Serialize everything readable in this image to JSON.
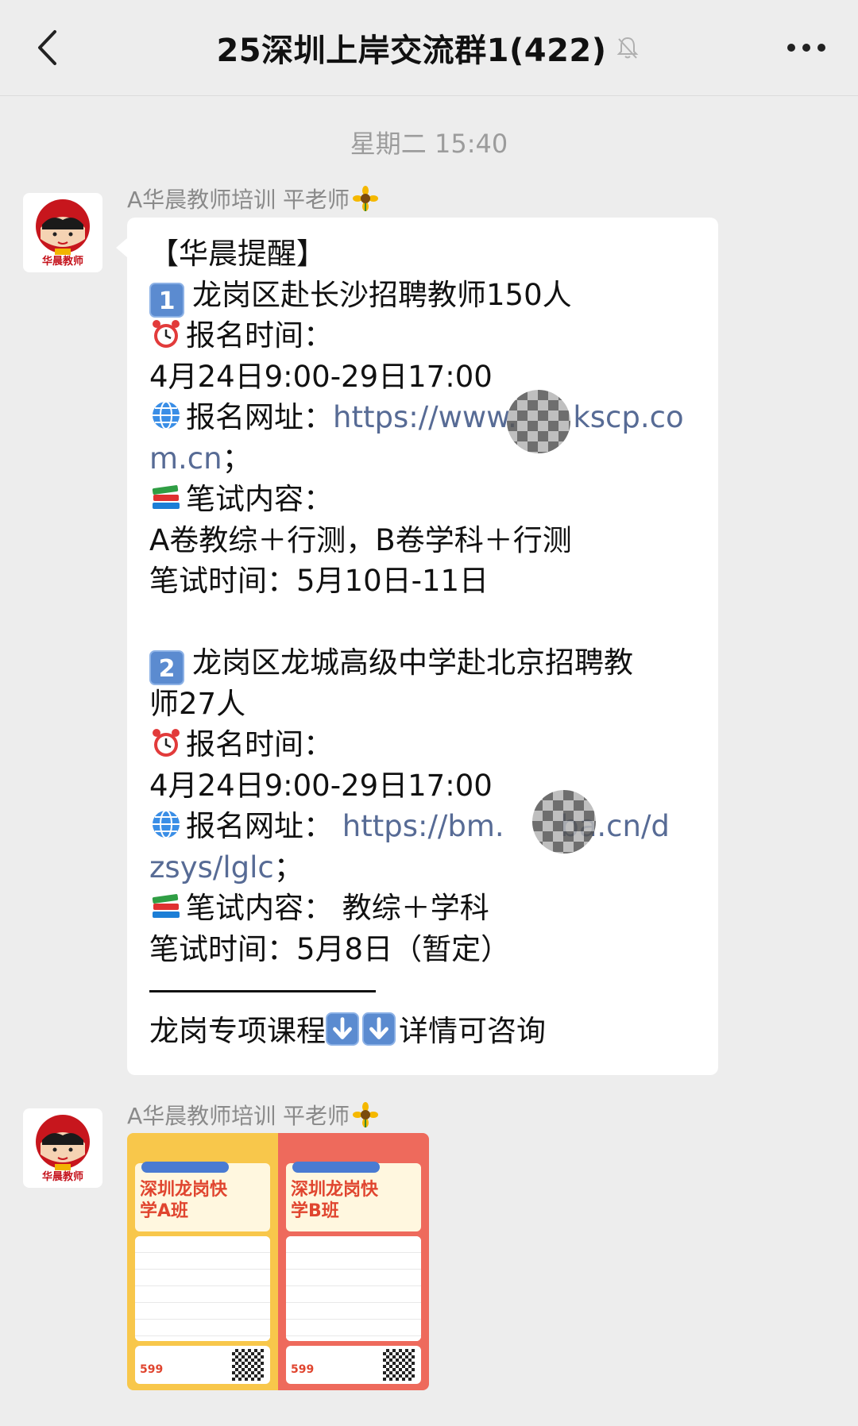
{
  "header": {
    "title": "25深圳上岸交流群1(422)",
    "back_icon": "chevron-left-icon",
    "mute_icon": "bell-off-icon",
    "more_icon": "more-dots-icon"
  },
  "timestamp": "星期二 15:40",
  "messages": [
    {
      "sender": "A华晨教师培训 平老师",
      "sender_emoji": "sunflower-icon",
      "avatar_brand": "华晨教师",
      "lines": [
        {
          "text": "【华晨提醒】"
        },
        {
          "prefix": "1",
          "text": "龙岗区赴长沙招聘教师150人"
        },
        {
          "emoji": "alarm-clock-icon",
          "text": "报名时间："
        },
        {
          "text": "4月24日9:00-29日17:00"
        },
        {
          "emoji": "globe-icon",
          "text": "报名网址：",
          "link": "https://www.      kscp.co"
        },
        {
          "link": "m.cn",
          "text": "；"
        },
        {
          "emoji": "books-icon",
          "text": "笔试内容："
        },
        {
          "text": "A卷教综＋行测，B卷学科＋行测"
        },
        {
          "text": "笔试时间：5月10日-11日"
        },
        {
          "text": ""
        },
        {
          "prefix": "2",
          "text": "龙岗区龙城高级中学赴北京招聘教"
        },
        {
          "text": "师27人"
        },
        {
          "emoji": "alarm-clock-icon",
          "text": "报名时间："
        },
        {
          "text": "4月24日9:00-29日17:00"
        },
        {
          "emoji": "globe-icon",
          "text": "报名网址： ",
          "link": "https://bm.      ba.cn/d"
        },
        {
          "link": "zsys/lglc",
          "text": "；"
        },
        {
          "emoji": "books-icon",
          "text": "笔试内容： 教综＋学科"
        },
        {
          "text": "笔试时间：5月8日（暂定）"
        },
        {
          "divider": true,
          "text": ""
        },
        {
          "text": "龙岗专项课程",
          "suffix_arrows": 2,
          "tail": "详情可咨询"
        }
      ]
    },
    {
      "sender": "A华晨教师培训 平老师",
      "sender_emoji": "sunflower-icon",
      "avatar_brand": "华晨教师",
      "image": {
        "posters": [
          {
            "title": "深圳龙岗快学A班",
            "price": "599",
            "color": "#f8c74b"
          },
          {
            "title": "深圳龙岗快学B班",
            "price": "599",
            "color": "#ee6a5c"
          }
        ]
      }
    }
  ]
}
